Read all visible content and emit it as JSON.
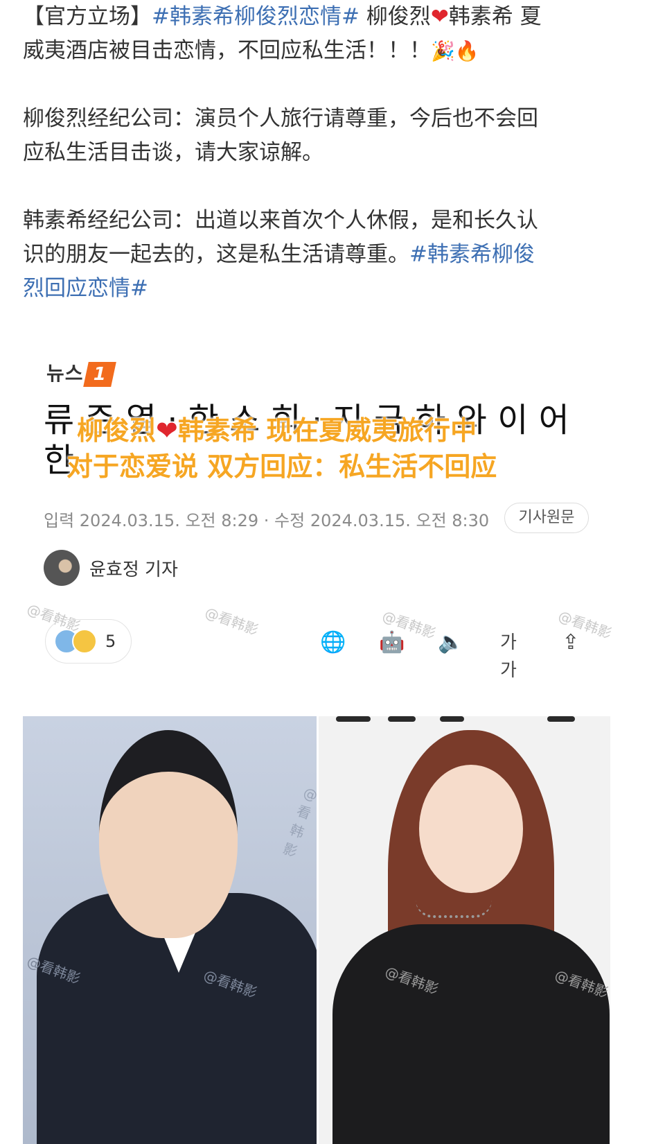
{
  "post": {
    "line1_prefix": "【官方立场】",
    "line1_tag": "#韩素希柳俊烈恋情#",
    "line1_name1": " 柳俊烈",
    "line1_heart": "❤",
    "line1_name2": "韩素希 夏",
    "line2_text": "威夷酒店被目击恋情，不回应私生活！！！",
    "line2_emoji": "🎉🔥",
    "para2_line1": "柳俊烈经纪公司：演员个人旅行请尊重，今后也不会回",
    "para2_line2": "应私生活目击谈，请大家谅解。",
    "para3_line1": "韩素希经纪公司：出道以来首次个人休假，是和长久认",
    "para3_line2_text": "识的朋友一起去的，这是私生活请尊重。",
    "para3_line2_tag": "#韩素希柳俊",
    "para3_line3_tag": "烈回应恋情#"
  },
  "article": {
    "logo_text": "뉴스",
    "logo_badge": "1",
    "headline_ko_line1": "류 준 열 · 한 소 희 · 지 금 하 와 이 어",
    "headline_ko_line2": "한",
    "overlay_line1_a": "柳俊烈",
    "overlay_heart": "❤",
    "overlay_line1_b": "韩素希 现在夏威夷旅行中",
    "overlay_line2": "对于恋爱说 双方回应：私生活不回应",
    "dateline": "입력 2024.03.15. 오전 8:29 · 수정 2024.03.15. 오전 8:30",
    "original_button": "기사원문",
    "reporter": "윤효정 기자",
    "reaction_count": "5",
    "font_size_label": "가가",
    "watermark": "@看韩影"
  },
  "icons": {
    "globe": "🌐",
    "robot": "🤖",
    "speaker": "🔈",
    "share": "⇪"
  }
}
